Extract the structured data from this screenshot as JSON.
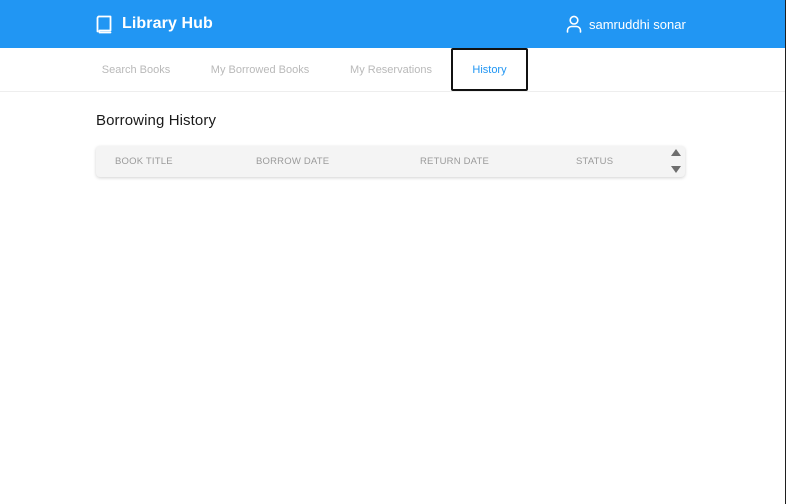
{
  "header": {
    "brand_name": "Library Hub",
    "user_name": "samruddhi sonar",
    "background_color": "#2196f3"
  },
  "tabs": [
    {
      "label": "Search Books",
      "active": false
    },
    {
      "label": "My Borrowed Books",
      "active": false
    },
    {
      "label": "My Reservations",
      "active": false
    },
    {
      "label": "History",
      "active": true
    }
  ],
  "main": {
    "title": "Borrowing History",
    "table": {
      "columns": [
        "BOOK TITLE",
        "BORROW DATE",
        "RETURN DATE",
        "STATUS"
      ],
      "rows": []
    }
  },
  "icons": {
    "brand": "book-icon",
    "user": "user-icon",
    "scroll_up": "scroll-up-arrow-icon",
    "scroll_down": "scroll-down-arrow-icon"
  },
  "colors": {
    "accent": "#2196f3",
    "tab_inactive": "#b9b9b9",
    "table_header_bg": "#f4f4f4"
  }
}
